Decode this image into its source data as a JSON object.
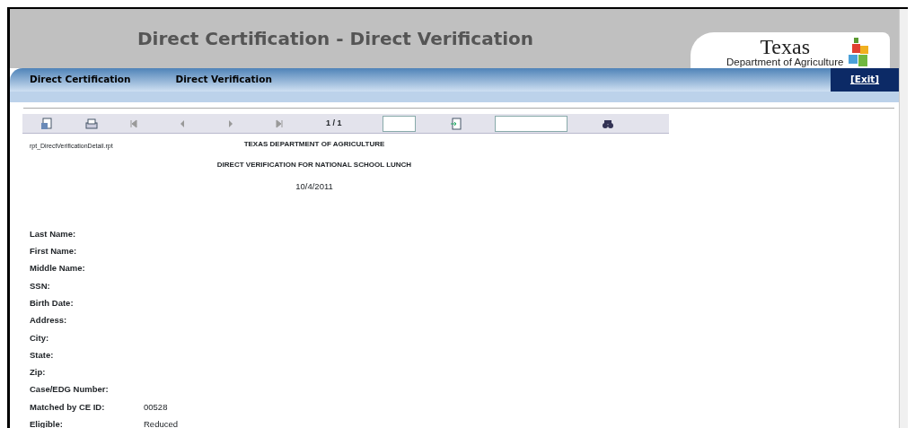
{
  "header": {
    "title": "Direct Certification - Direct Verification",
    "logo": {
      "name": "Texas",
      "subtitle": "Department of Agriculture"
    }
  },
  "nav": {
    "items": [
      {
        "label": "Direct Certification"
      },
      {
        "label": "Direct Verification"
      }
    ],
    "exit": "[Exit]"
  },
  "toolbar": {
    "page": "1 / 1"
  },
  "report": {
    "file": "rpt_DirectVerificationDetail.rpt",
    "agency": "TEXAS DEPARTMENT OF AGRICULTURE",
    "title": "DIRECT VERIFICATION FOR NATIONAL SCHOOL LUNCH",
    "date": "10/4/2011",
    "fields": [
      {
        "label": "Last Name:"
      },
      {
        "label": "First Name:"
      },
      {
        "label": "Middle Name:"
      },
      {
        "label": "SSN:"
      },
      {
        "label": "Birth Date:"
      },
      {
        "label": "Address:"
      },
      {
        "label": "City:"
      },
      {
        "label": "State:"
      },
      {
        "label": "Zip:"
      },
      {
        "label": "Case/EDG Number:"
      },
      {
        "label": "Matched by CE ID:",
        "value": "00528"
      },
      {
        "label": "Eligible:",
        "value": "Reduced"
      }
    ]
  }
}
